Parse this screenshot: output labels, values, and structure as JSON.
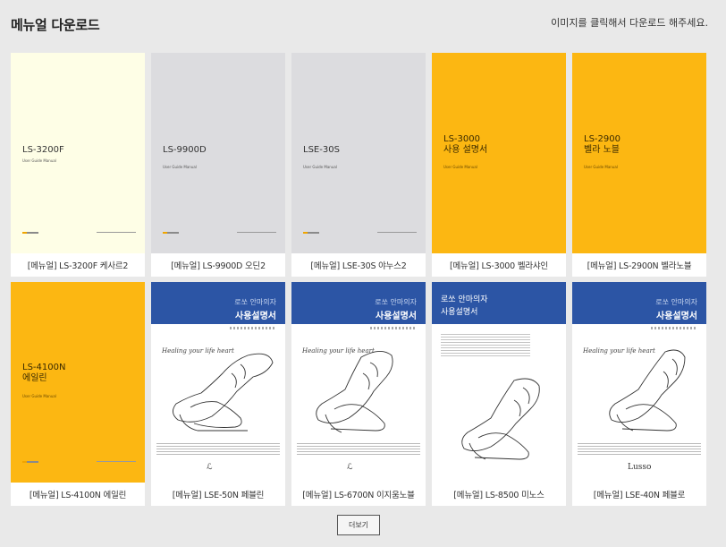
{
  "header": {
    "title": "메뉴얼 다운로드",
    "hint": "이미지를 클릭해서 다운로드 해주세요."
  },
  "cards": [
    {
      "caption": "[메뉴얼] LS-3200F 케사르2",
      "model": "LS-3200F",
      "guide": "User Guide Manual"
    },
    {
      "caption": "[메뉴얼] LS-9900D 오딘2",
      "model": "LS-9900D",
      "guide": "User Guide Manual"
    },
    {
      "caption": "[메뉴얼] LSE-30S 야누스2",
      "model": "LSE-30S",
      "guide": "User Guide Manual"
    },
    {
      "caption": "[메뉴얼] LS-3000 벨라샤인",
      "model": "LS-3000\n사용 설명서",
      "guide": "User Guide Manual"
    },
    {
      "caption": "[메뉴얼] LS-2900N 벨라노블",
      "model": "LS-2900\n벨라 노블",
      "guide": "User Guide Manual"
    },
    {
      "caption": "[메뉴얼] LS-4100N 에일린",
      "model": "LS-4100N\n에일린",
      "guide": "User Guide Manual"
    },
    {
      "caption": "[메뉴얼] LSE-50N 페블린",
      "band_small": "로쏘 안마의자",
      "band_big": "사용설명서",
      "script": "Healing your life heart"
    },
    {
      "caption": "[메뉴얼] LS-6700N 이지움노블",
      "band_small": "로쏘 안마의자",
      "band_big": "사용설명서",
      "script": "Healing your life heart"
    },
    {
      "caption": "[메뉴얼] LS-8500 미노스",
      "band_small": "로쏘 안마의자",
      "band_big": "사용설명서"
    },
    {
      "caption": "[메뉴얼] LSE-40N 페블로",
      "band_small": "로쏘 안마의자",
      "band_big": "사용설명서",
      "script": "Healing your life heart",
      "sig": "Lusso"
    }
  ],
  "more_button": {
    "label": "더보기"
  }
}
